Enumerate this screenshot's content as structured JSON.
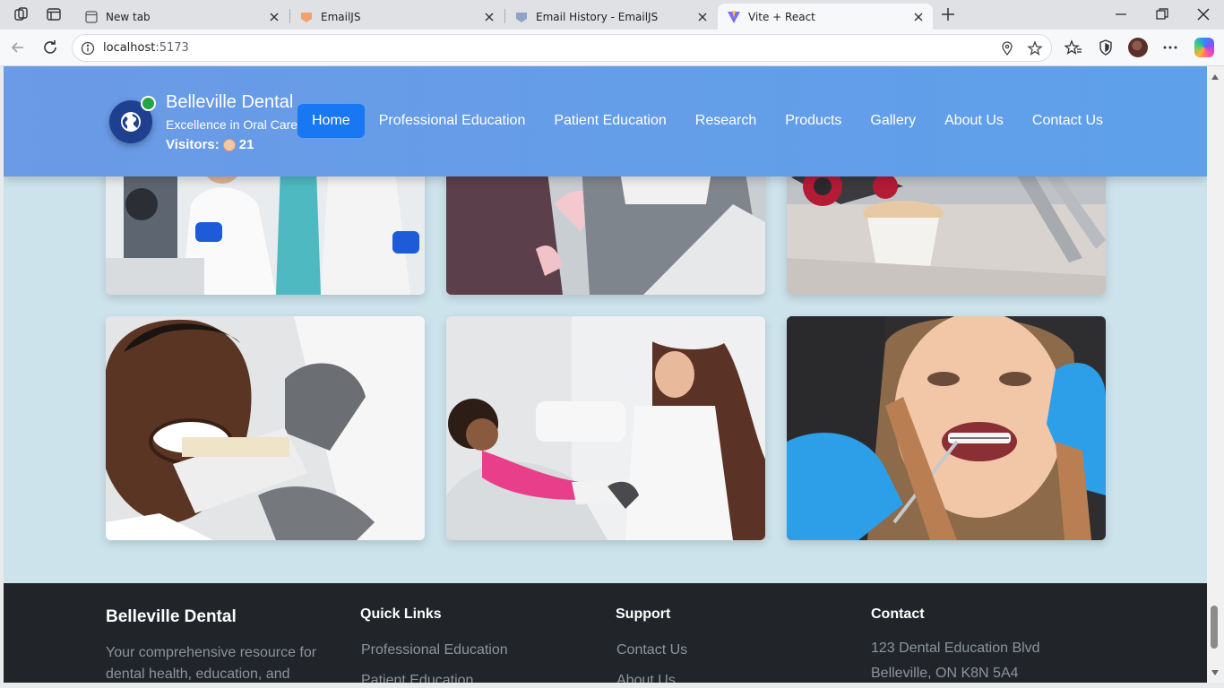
{
  "browser": {
    "tabs": [
      {
        "title": "New tab",
        "icon": "new-tab-page-icon"
      },
      {
        "title": "EmailJS",
        "icon": "emailjs-favicon"
      },
      {
        "title": "Email History - EmailJS",
        "icon": "emailjs-favicon"
      },
      {
        "title": "Vite + React",
        "icon": "vite-favicon"
      }
    ],
    "url": {
      "host": "localhost",
      "port": ":5173"
    }
  },
  "header": {
    "brand_title": "Belleville Dental",
    "brand_subtitle": "Excellence in Oral Care",
    "visitors_label": "Visitors:",
    "visitors_count": "21",
    "nav": [
      {
        "label": "Home",
        "active": true
      },
      {
        "label": "Professional Education"
      },
      {
        "label": "Patient Education"
      },
      {
        "label": "Research"
      },
      {
        "label": "Products"
      },
      {
        "label": "Gallery"
      },
      {
        "label": "About Us"
      },
      {
        "label": "Contact Us"
      }
    ]
  },
  "gallery": {
    "photos": [
      "dentists-in-lab-photo",
      "dental-procedure-photo",
      "dental-model-photo",
      "smiling-man-shade-guide-photo",
      "child-in-dental-chair-photo",
      "orthodontic-braces-photo"
    ]
  },
  "footer": {
    "brand": "Belleville Dental",
    "description": "Your comprehensive resource for dental health, education, and",
    "quick_links": {
      "title": "Quick Links",
      "items": [
        "Professional Education",
        "Patient Education"
      ]
    },
    "support": {
      "title": "Support",
      "items": [
        "Contact Us",
        "About Us"
      ]
    },
    "contact": {
      "title": "Contact",
      "lines": [
        "123 Dental Education Blvd",
        "Belleville, ON K8N 5A4"
      ]
    }
  },
  "colors": {
    "header_gradient_start": "#6b9ae6",
    "nav_active": "#1877f2",
    "page_background": "#cde3ec",
    "footer_background": "#212529",
    "online_indicator": "#22a447"
  }
}
